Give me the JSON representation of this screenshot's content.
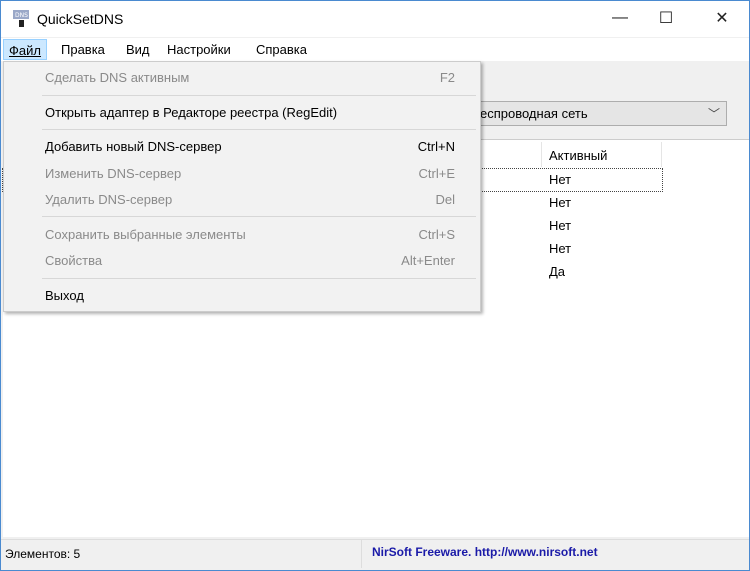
{
  "window": {
    "title": "QuickSetDNS",
    "minimize": "—",
    "maximize": "☐",
    "close": "✕"
  },
  "menubar": [
    {
      "label": "Файл"
    },
    {
      "label": "Правка"
    },
    {
      "label": "Вид"
    },
    {
      "label": "Настройки"
    },
    {
      "label": "Справка"
    }
  ],
  "adapter_combo": {
    "value": "еспроводная сеть"
  },
  "table": {
    "columns": [
      "Активный"
    ],
    "rows": [
      [
        "Нет"
      ],
      [
        "Нет"
      ],
      [
        "Нет"
      ],
      [
        "Нет"
      ],
      [
        "Да"
      ]
    ]
  },
  "file_menu": [
    {
      "label": "Сделать DNS активным",
      "shortcut": "F2",
      "disabled": true
    },
    {
      "label": "Открыть адаптер в Редакторе реестра (RegEdit)",
      "shortcut": "",
      "disabled": false
    },
    {
      "label": "Добавить новый DNS-сервер",
      "shortcut": "Ctrl+N",
      "disabled": false
    },
    {
      "label": "Изменить DNS-сервер",
      "shortcut": "Ctrl+E",
      "disabled": true
    },
    {
      "label": "Удалить DNS-сервер",
      "shortcut": "Del",
      "disabled": true
    },
    {
      "label": "Сохранить выбранные элементы",
      "shortcut": "Ctrl+S",
      "disabled": true
    },
    {
      "label": "Свойства",
      "shortcut": "Alt+Enter",
      "disabled": true
    },
    {
      "label": "Выход",
      "shortcut": "",
      "disabled": false
    }
  ],
  "status": {
    "count": "Элементов: 5",
    "credit": "NirSoft Freeware.  http://www.nirsoft.net"
  }
}
